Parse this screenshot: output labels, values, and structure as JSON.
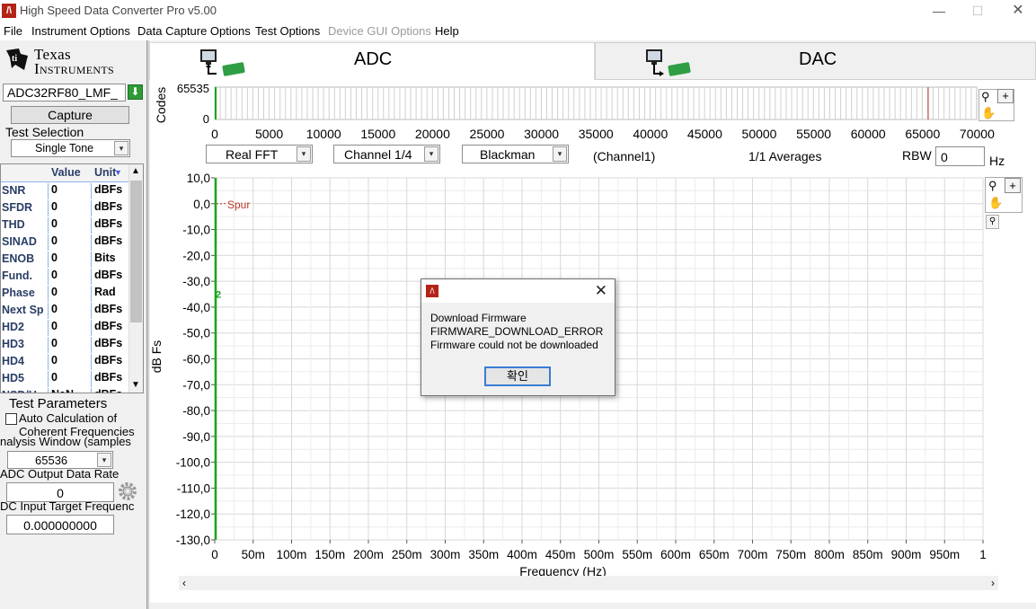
{
  "window": {
    "title": "High Speed Data Converter Pro v5.00",
    "logo_glyph": "/\\",
    "min_glyph": "—",
    "max_glyph": "☐",
    "close_glyph": "✕"
  },
  "menu": [
    "File",
    "Instrument Options",
    "Data Capture Options",
    "Test Options",
    "Device GUI Options",
    "Help"
  ],
  "left": {
    "logo_text_1": "Texas",
    "logo_text_2": "Instruments",
    "device": "ADC32RF80_LMF_",
    "capture_label": "Capture",
    "test_selection_label": "Test Selection",
    "test_selection_value": "Single Tone",
    "table_headers": {
      "value": "Value",
      "unit": "Unit"
    },
    "table_rows": [
      {
        "name": "SNR",
        "value": "0",
        "unit": "dBFs"
      },
      {
        "name": "SFDR",
        "value": "0",
        "unit": "dBFs"
      },
      {
        "name": "THD",
        "value": "0",
        "unit": "dBFs"
      },
      {
        "name": "SINAD",
        "value": "0",
        "unit": "dBFs"
      },
      {
        "name": "ENOB",
        "value": "0",
        "unit": "Bits"
      },
      {
        "name": "Fund.",
        "value": "0",
        "unit": "dBFs"
      },
      {
        "name": "Phase",
        "value": "0",
        "unit": "Rad"
      },
      {
        "name": "Next Sp",
        "value": "0",
        "unit": "dBFs"
      },
      {
        "name": "HD2",
        "value": "0",
        "unit": "dBFs"
      },
      {
        "name": "HD3",
        "value": "0",
        "unit": "dBFs"
      },
      {
        "name": "HD4",
        "value": "0",
        "unit": "dBFs"
      },
      {
        "name": "HD5",
        "value": "0",
        "unit": "dBFs"
      },
      {
        "name": "NSD/Hz",
        "value": "NaN",
        "unit": "dBFs"
      }
    ],
    "test_parameters_label": "Test Parameters",
    "auto_calc_label_1": "Auto Calculation of",
    "auto_calc_label_2": "Coherent Frequencies",
    "analysis_window_label": "nalysis Window (samples",
    "analysis_window_value": "65536",
    "adc_rate_label": "ADC Output Data Rate",
    "adc_rate_value": "0",
    "target_freq_label": "DC Input Target Frequenc",
    "target_freq_value": "0.000000000"
  },
  "tabs": {
    "adc": "ADC",
    "dac": "DAC"
  },
  "codes_axis": {
    "ylabel": "Codes",
    "ytop": "65535",
    "ybottom": "0",
    "xticks": [
      "0",
      "5000",
      "10000",
      "15000",
      "20000",
      "25000",
      "30000",
      "35000",
      "40000",
      "45000",
      "50000",
      "55000",
      "60000",
      "65000",
      "70000"
    ]
  },
  "controls": {
    "fft_type": "Real FFT",
    "channel": "Channel 1/4",
    "window": "Blackman",
    "channel_note": "(Channel1)",
    "averages": "1/1 Averages",
    "rbw_label": "RBW",
    "rbw_value": "0",
    "rbw_unit": "Hz"
  },
  "fft_plot": {
    "ylabel": "dB Fs",
    "xlabel": "Frequency (Hz)",
    "yticks": [
      "10,0",
      "0,0",
      "-10,0",
      "-20,0",
      "-30,0",
      "-40,0",
      "-50,0",
      "-60,0",
      "-70,0",
      "-80,0",
      "-90,0",
      "-100,0",
      "-110,0",
      "-120,0",
      "-130,0"
    ],
    "xticks": [
      "0",
      "50m",
      "100m",
      "150m",
      "200m",
      "250m",
      "300m",
      "350m",
      "400m",
      "450m",
      "500m",
      "550m",
      "600m",
      "650m",
      "700m",
      "750m",
      "800m",
      "850m",
      "900m",
      "950m",
      "1"
    ],
    "spur_label": "Spur",
    "marker_label": "2"
  },
  "dialog": {
    "line1": "Download Firmware",
    "line2": "FIRMWARE_DOWNLOAD_ERROR",
    "line3": "Firmware could not be downloaded",
    "ok_label": "확인",
    "close_glyph": "✕"
  },
  "colors": {
    "trace": "#1aa51a",
    "spur": "#c0392b",
    "grid": "#d8d8d8"
  }
}
